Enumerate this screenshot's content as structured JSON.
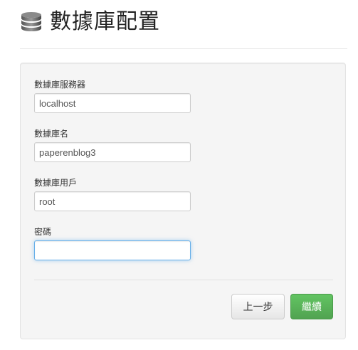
{
  "header": {
    "title": "數據庫配置",
    "icon": "database-icon"
  },
  "form": {
    "server": {
      "label": "數據庫服務器",
      "value": "localhost"
    },
    "dbname": {
      "label": "數據庫名",
      "value": "paperenblog3"
    },
    "user": {
      "label": "數據庫用戶",
      "value": "root"
    },
    "password": {
      "label": "密碼",
      "value": ""
    }
  },
  "actions": {
    "back_label": "上一步",
    "next_label": "繼續"
  },
  "colors": {
    "accent_green": "#5bb75b",
    "focus_blue": "#66afe9",
    "panel_bg": "#f5f5f5"
  }
}
